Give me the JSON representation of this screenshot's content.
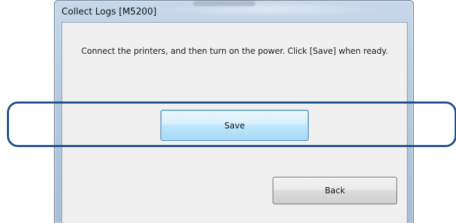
{
  "window": {
    "title": "Collect Logs [M5200]"
  },
  "dialog": {
    "message": "Connect the printers, and then turn on the power. Click [Save] when ready.",
    "save_label": "Save",
    "back_label": "Back"
  },
  "colors": {
    "highlight_border": "#1f4f8a",
    "save_button_accent": "#3c7fb1",
    "client_background": "#f0f0f0"
  }
}
